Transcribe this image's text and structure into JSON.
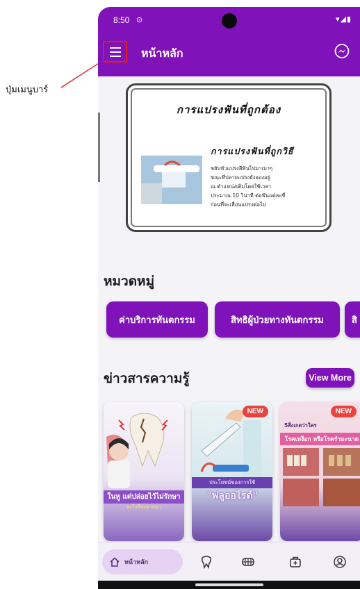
{
  "annotation": {
    "label": "ปุ่มเมนูบาร์"
  },
  "status_bar": {
    "time": "8:50",
    "icons": "▾◢▮"
  },
  "app_bar": {
    "title": "หน้าหลัก",
    "menu_icon": "hamburger-menu-icon",
    "chat_icon": "messenger-icon"
  },
  "banner": {
    "title": "การแปรงฟันที่ถูกต้อง",
    "subtitle": "การแปรงฟันที่ถูกวิธี",
    "body": "ขยับหัวแปรงสีฟันไปมาเบาๆ\nขณะที่ปลายแปรงยังจองอยู่\nณ ตำแหน่งเดิมโดยใช้เวลา\nประมาณ 10 วินาที ต่อฟันแต่ละซี่\nก่อนที่จะเลื่อนแปรงต่อไป"
  },
  "categories": {
    "title": "หมวดหมู่",
    "items": [
      {
        "label": "ค่าบริการทันตกรรม"
      },
      {
        "label": "สิทธิผู้ป่วยทางทันตกรรม"
      },
      {
        "label": "สิ"
      }
    ]
  },
  "news": {
    "title": "ข่าวสารความรู้",
    "view_more": "View More",
    "cards": [
      {
        "caption": "ในหู แต่ปล่อยไว้ไม่รักษา",
        "sub": "อะไรที่จะตามมา",
        "badge": ""
      },
      {
        "caption": "\"ฟลูออไรด์\"",
        "sub": "ประโยชน์ของการใช้",
        "badge": "NEW"
      },
      {
        "caption": "โรคเหงือก หรือโรครำมะนาด",
        "sub": "5สิ่งเกตว่าใคร",
        "badge": "NEW"
      }
    ]
  },
  "bottom_nav": {
    "home_label": "หน้าหลัก",
    "items": [
      "home-icon",
      "tooth-icon",
      "dentures-icon",
      "medical-bag-icon",
      "profile-icon"
    ]
  },
  "colors": {
    "primary": "#7f12b8",
    "new_badge": "#e8433f",
    "nav_bg": "#f3eff7"
  }
}
